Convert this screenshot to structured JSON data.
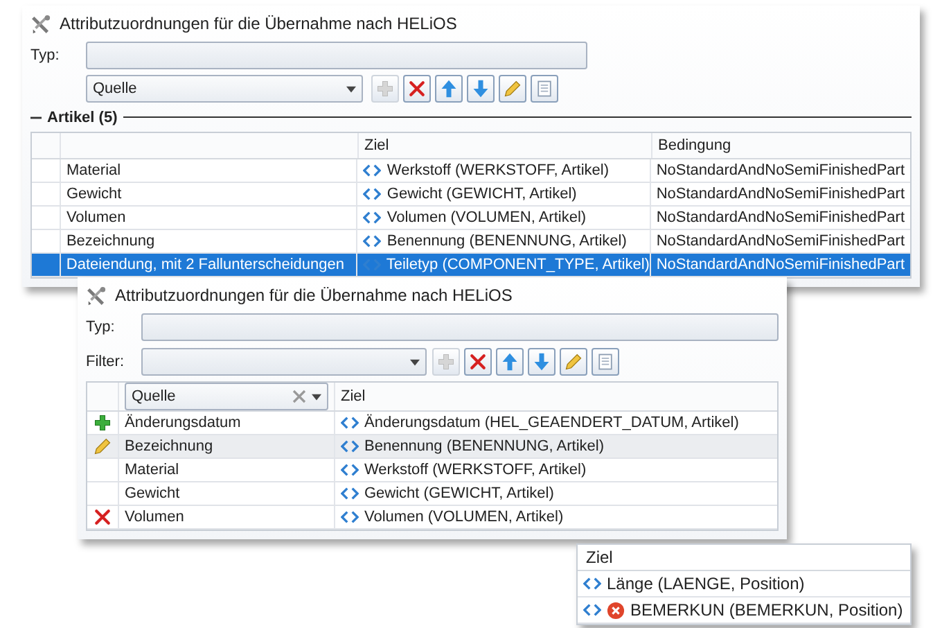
{
  "main_window": {
    "title": "Attributzuordnungen für die Übernahme nach HELiOS",
    "type_label": "Typ:",
    "source_dropdown": {
      "placeholder": "Quelle"
    },
    "toolbar": [
      {
        "kind": "add",
        "disabled": true
      },
      {
        "kind": "delete",
        "disabled": false
      },
      {
        "kind": "up",
        "disabled": false
      },
      {
        "kind": "down",
        "disabled": false
      },
      {
        "kind": "edit",
        "disabled": false
      },
      {
        "kind": "copy",
        "disabled": false
      }
    ],
    "group": {
      "label": "Artikel (5)",
      "expanded": true
    },
    "columns": [
      "Ziel",
      "Bedingung"
    ],
    "rows": [
      {
        "source": "Material",
        "target": "Werkstoff (WERKSTOFF, Artikel)",
        "condition": "NoStandardAndNoSemiFinishedPart",
        "selected": false
      },
      {
        "source": "Gewicht",
        "target": "Gewicht (GEWICHT, Artikel)",
        "condition": "NoStandardAndNoSemiFinishedPart",
        "selected": false
      },
      {
        "source": "Volumen",
        "target": "Volumen (VOLUMEN, Artikel)",
        "condition": "NoStandardAndNoSemiFinishedPart",
        "selected": false
      },
      {
        "source": "Bezeichnung",
        "target": "Benennung (BENENNUNG, Artikel)",
        "condition": "NoStandardAndNoSemiFinishedPart",
        "selected": false
      },
      {
        "source": "Dateiendung, mit 2 Fallunterscheidungen",
        "target": "Teiletyp (COMPONENT_TYPE, Artikel)",
        "condition": "NoStandardAndNoSemiFinishedPart",
        "selected": true
      }
    ]
  },
  "second_window": {
    "title": "Attributzuordnungen für die Übernahme nach HELiOS",
    "type_label": "Typ:",
    "filter_label": "Filter:",
    "source_dropdown": {
      "placeholder": "Quelle"
    },
    "toolbar": [
      {
        "kind": "add",
        "disabled": true
      },
      {
        "kind": "delete",
        "disabled": false
      },
      {
        "kind": "up",
        "disabled": false
      },
      {
        "kind": "down",
        "disabled": false
      },
      {
        "kind": "edit",
        "disabled": false
      },
      {
        "kind": "copy",
        "disabled": false
      }
    ],
    "columns": [
      "Ziel"
    ],
    "rows": [
      {
        "kind": "added",
        "source": "Änderungsdatum",
        "target": "Änderungsdatum (HEL_GEAENDERT_DATUM, Artikel)",
        "selected": false
      },
      {
        "kind": "edited",
        "source": "Bezeichnung",
        "target": "Benennung (BENENNUNG, Artikel)",
        "selected": true
      },
      {
        "kind": "plain",
        "source": "Material",
        "target": "Werkstoff (WERKSTOFF, Artikel)",
        "selected": false
      },
      {
        "kind": "plain",
        "source": "Gewicht",
        "target": "Gewicht (GEWICHT, Artikel)",
        "selected": false
      },
      {
        "kind": "removed",
        "source": "Volumen",
        "target": "Volumen (VOLUMEN, Artikel)",
        "selected": false
      }
    ]
  },
  "target_popup": {
    "header": "Ziel",
    "items": [
      {
        "label": "Länge (LAENGE, Position)",
        "error": false
      },
      {
        "label": "BEMERKUN (BEMERKUN, Position)",
        "error": true
      }
    ]
  }
}
